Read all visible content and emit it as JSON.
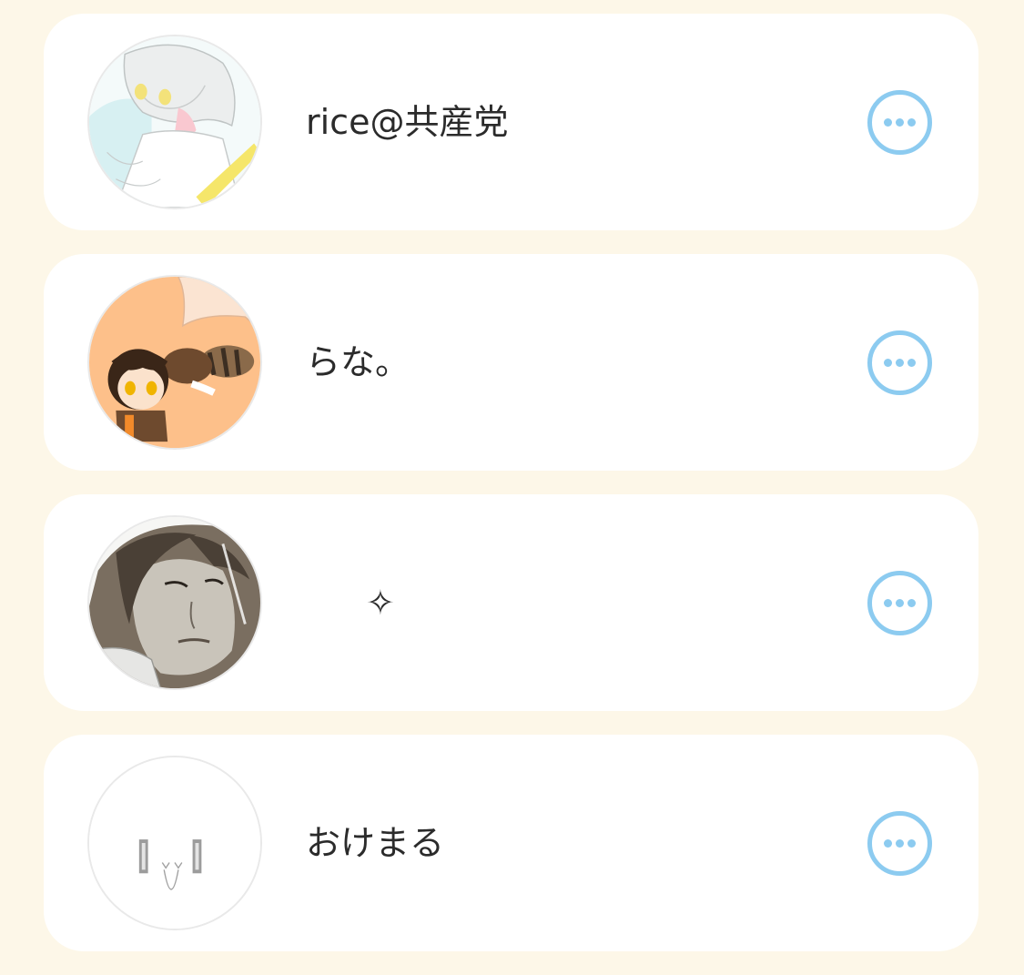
{
  "colors": {
    "background": "#fdf7e8",
    "card": "#ffffff",
    "accent": "#8ccbf0",
    "text": "#2b2b2b"
  },
  "users": [
    {
      "name": "rice@共産党",
      "avatar": "anime-white-hair-avatar",
      "more_icon": "more-options-icon"
    },
    {
      "name": "らな。",
      "avatar": "chibi-raccoon-avatar",
      "more_icon": "more-options-icon"
    },
    {
      "name": "✧",
      "avatar": "manga-portrait-avatar",
      "more_icon": "more-options-icon"
    },
    {
      "name": "おけまる",
      "avatar": "simple-face-avatar",
      "more_icon": "more-options-icon"
    }
  ]
}
